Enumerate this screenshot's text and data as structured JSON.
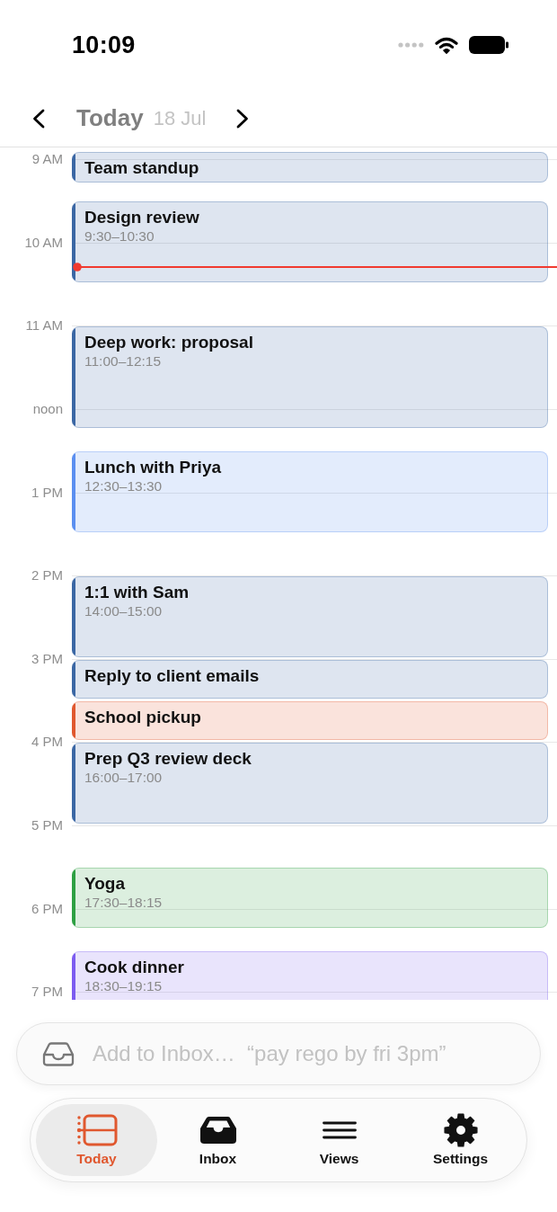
{
  "status_bar": {
    "time": "10:09"
  },
  "header": {
    "title": "Today",
    "date": "18 Jul"
  },
  "timeline": {
    "hour_labels": [
      "9 AM",
      "10 AM",
      "11 AM",
      "noon",
      "1 PM",
      "2 PM",
      "3 PM",
      "4 PM",
      "5 PM",
      "6 PM",
      "7 PM"
    ],
    "now_line": true,
    "events": [
      {
        "title": "Team standup",
        "color": "#3b67a4"
      },
      {
        "title": "Design review",
        "time": "9:30–10:30",
        "color": "#3b67a4"
      },
      {
        "title": "Deep work: proposal",
        "time": "11:00–12:15",
        "color": "#3b67a4"
      },
      {
        "title": "Lunch with Priya",
        "time": "12:30–13:30",
        "color": "#5b8ff0"
      },
      {
        "title": "1:1 with Sam",
        "time": "14:00–15:00",
        "color": "#3b67a4"
      },
      {
        "title": "Reply to client emails",
        "color": "#3b67a4"
      },
      {
        "title": "School pickup",
        "color": "#e0582f"
      },
      {
        "title": "Prep Q3 review deck",
        "time": "16:00–17:00",
        "color": "#3b67a4"
      },
      {
        "title": "Yoga",
        "time": "17:30–18:15",
        "color": "#2ea043"
      },
      {
        "title": "Cook dinner",
        "time": "18:30–19:15",
        "color": "#7c5cf0"
      }
    ]
  },
  "quick_add": {
    "placeholder": "Add to Inbox…  “pay rego by fri 3pm”"
  },
  "tabs": [
    {
      "label": "Today",
      "selected": true
    },
    {
      "label": "Inbox",
      "selected": false
    },
    {
      "label": "Views",
      "selected": false
    },
    {
      "label": "Settings",
      "selected": false
    }
  ]
}
